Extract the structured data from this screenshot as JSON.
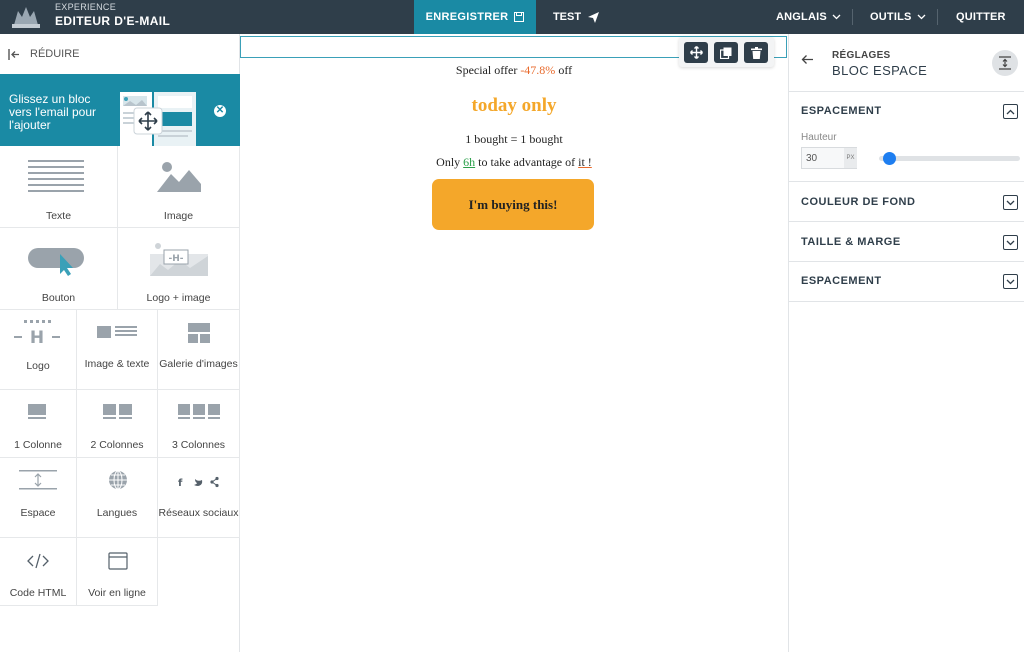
{
  "topbar": {
    "brand_small": "EXPERIENCE",
    "brand_title": "EDITEUR D'E-MAIL",
    "save_label": "ENREGISTRER",
    "test_label": "TEST",
    "language_label": "ANGLAIS",
    "tools_label": "OUTILS",
    "quit_label": "QUITTER"
  },
  "left": {
    "reduce_label": "RÉDUIRE",
    "banner_text": "Glissez un bloc vers l'email pour l'ajouter",
    "blocks": [
      {
        "label": "Texte"
      },
      {
        "label": "Image"
      },
      {
        "label": "Bouton"
      },
      {
        "label": "Logo + image"
      },
      {
        "label": "Logo"
      },
      {
        "label": "Image & texte"
      },
      {
        "label": "Galerie d'images"
      },
      {
        "label": "1 Colonne"
      },
      {
        "label": "2 Colonnes"
      },
      {
        "label": "3 Colonnes"
      },
      {
        "label": "Espace"
      },
      {
        "label": "Langues"
      },
      {
        "label": "Réseaux sociaux"
      },
      {
        "label": "Code HTML"
      },
      {
        "label": "Voir en ligne"
      }
    ]
  },
  "email": {
    "offer_prefix": "Special offer ",
    "offer_pct": "-47.8%",
    "offer_suffix": " off",
    "headline": "today only",
    "bought": "1 bought = 1 bought",
    "only_prefix": "Only ",
    "only_hours": "6h",
    "only_mid": " to take advantage of ",
    "only_it": "it !",
    "button": "I'm buying this!"
  },
  "right": {
    "settings_label": "RÉGLAGES",
    "block_title": "BLOC ESPACE",
    "sections": [
      {
        "title": "ESPACEMENT",
        "open": true
      },
      {
        "title": "COULEUR DE FOND",
        "open": false
      },
      {
        "title": "TAILLE & MARGE",
        "open": false
      },
      {
        "title": "ESPACEMENT",
        "open": false
      }
    ],
    "height_label": "Hauteur",
    "height_value": "30",
    "height_unit": "PX",
    "slider_level": 0.03
  },
  "colors": {
    "topbar": "#2f3e4a",
    "accent": "#1a8aa4",
    "orange": "#f4a72a",
    "slider_knob": "#1e7ef0"
  }
}
